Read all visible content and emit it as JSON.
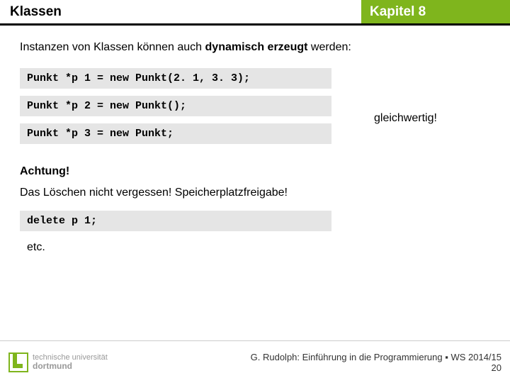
{
  "header": {
    "left": "Klassen",
    "right": "Kapitel 8"
  },
  "intro": {
    "pre": "Instanzen von Klassen können auch ",
    "bold": "dynamisch erzeugt",
    "post": " werden:"
  },
  "code": {
    "line1": "Punkt *p 1 = new Punkt(2. 1, 3. 3);",
    "line2": "Punkt *p 2 = new Punkt();",
    "line3": "Punkt *p 3 = new Punkt;",
    "annot": "gleichwertig!"
  },
  "warn": {
    "title": "Achtung!",
    "text": "Das Löschen nicht vergessen! Speicherplatzfreigabe!"
  },
  "deletecode": "delete p 1;",
  "etc": "etc.",
  "footer": {
    "uni1": "technische universität",
    "uni2": "dortmund",
    "credit": "G. Rudolph: Einführung in die Programmierung ▪ WS 2014/15",
    "slidenum": "20"
  }
}
